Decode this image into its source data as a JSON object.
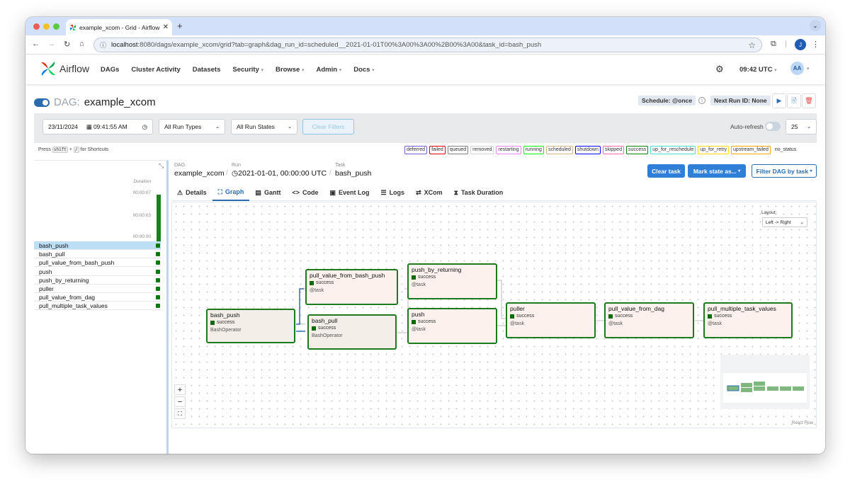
{
  "browser": {
    "tab_title": "example_xcom - Grid - Airflow",
    "url_host": "localhost",
    "url_rest": ":8080/dags/example_xcom/grid?tab=graph&dag_run_id=scheduled__2021-01-01T00%3A00%3A00%2B00%3A00&task_id=bash_push",
    "profile_initial": "J"
  },
  "nav": {
    "brand": "Airflow",
    "items": [
      "DAGs",
      "Cluster Activity",
      "Datasets",
      "Security",
      "Browse",
      "Admin",
      "Docs"
    ],
    "time": "09:42 UTC",
    "avatar": "AA"
  },
  "dag": {
    "label": "DAG:",
    "name": "example_xcom",
    "schedule": "Schedule: @once",
    "next_run": "Next Run ID: None"
  },
  "filters": {
    "date": "23/11/2024",
    "time": "09:41:55 AM",
    "run_types": "All Run Types",
    "run_states": "All Run States",
    "clear": "Clear Filters",
    "auto_refresh": "Auto-refresh",
    "count": "25"
  },
  "shortcuts": {
    "press": "Press",
    "key1": "shift",
    "plus": "+",
    "key2": "/",
    "rest": "for Shortcuts"
  },
  "legend": [
    "deferred",
    "failed",
    "queued",
    "removed",
    "restarting",
    "running",
    "scheduled",
    "shutdown",
    "skipped",
    "success",
    "up_for_reschedule",
    "up_for_retry",
    "upstream_failed",
    "no_status"
  ],
  "legend_colors": [
    "#7b5ad6",
    "#e00000",
    "#808080",
    "#d3d3d3",
    "#ee82ee",
    "#00ff00",
    "#d2b48c",
    "#0000ff",
    "#ff69b4",
    "#008000",
    "#40e0d0",
    "#ffd700",
    "#ffa500",
    "#ffffff"
  ],
  "grid": {
    "duration_label": "Duration",
    "ticks": [
      "00:00:07",
      "00:00:03",
      "00:00:00"
    ],
    "tasks": [
      "bash_push",
      "bash_pull",
      "pull_value_from_bash_push",
      "push",
      "push_by_returning",
      "puller",
      "pull_value_from_dag",
      "pull_multiple_task_values"
    ],
    "selected": "bash_push"
  },
  "breadcrumb": {
    "dag_label": "DAG",
    "dag_value": "example_xcom",
    "run_label": "Run",
    "run_value": "2021-01-01, 00:00:00 UTC",
    "task_label": "Task",
    "task_value": "bash_push"
  },
  "actions": {
    "clear_task": "Clear task",
    "mark_state": "Mark state as...",
    "filter_dag": "Filter DAG by task"
  },
  "tabs": [
    "Details",
    "Graph",
    "Gantt",
    "Code",
    "Event Log",
    "Logs",
    "XCom",
    "Task Duration"
  ],
  "active_tab": "Graph",
  "layout": {
    "label": "Layout:",
    "value": "Left -> Right"
  },
  "nodes": [
    {
      "name": "bash_push",
      "status": "success",
      "operator": "BashOperator"
    },
    {
      "name": "pull_value_from_bash_push",
      "status": "success",
      "operator": "@task"
    },
    {
      "name": "bash_pull",
      "status": "success",
      "operator": "BashOperator"
    },
    {
      "name": "push_by_returning",
      "status": "success",
      "operator": "@task"
    },
    {
      "name": "push",
      "status": "success",
      "operator": "@task"
    },
    {
      "name": "puller",
      "status": "success",
      "operator": "@task"
    },
    {
      "name": "pull_value_from_dag",
      "status": "success",
      "operator": "@task"
    },
    {
      "name": "pull_multiple_task_values",
      "status": "success",
      "operator": "@task"
    }
  ],
  "attribution": "React Flow"
}
